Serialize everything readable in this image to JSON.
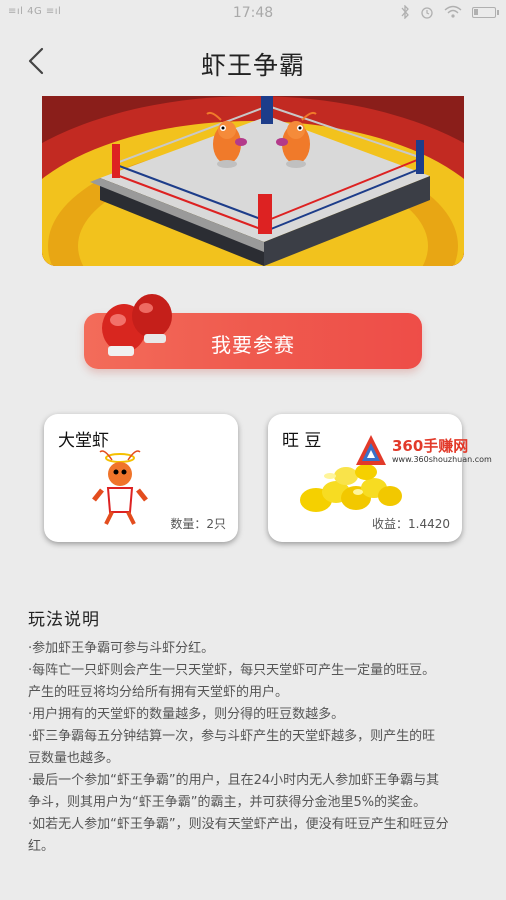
{
  "status_bar": {
    "signal_text": "≡ıl 4G ≡ıl",
    "time": "17:48"
  },
  "header": {
    "title": "虾王争霸",
    "back_icon": "chevron-left-icon"
  },
  "join_button": {
    "label": "我要参赛"
  },
  "cards": {
    "shrimp": {
      "title": "大堂虾",
      "value": "数量：2只"
    },
    "beans": {
      "title": "旺 豆",
      "value": "收益：1.4420"
    }
  },
  "watermark": {
    "title": "360手赚网",
    "url": "www.360shouzhuan.com"
  },
  "rules": {
    "title": "玩法说明",
    "lines": [
      "·参加虾王争霸可参与斗虾分红。",
      "·每阵亡一只虾则会产生一只天堂虾，每只天堂虾可产生一定量的旺豆。",
      "产生的旺豆将均分给所有拥有天堂虾的用户。",
      "·用户拥有的天堂虾的数量越多，则分得的旺豆数越多。",
      "·虾三争霸每五分钟结算一次，参与斗虾产生的天堂虾越多，则产生的旺",
      "豆数量也越多。",
      "·最后一个参加“虾王争霸”的用户，且在24小时内无人参加虾王争霸与其",
      "争斗，则其用户为“虾王争霸”的霸主，并可获得分金池里5%的奖金。",
      "·如若无人参加“虾王争霸”，则没有天堂虾产出，便没有旺豆产生和旺豆分",
      "红。"
    ]
  },
  "colors": {
    "background": "#ebebeb",
    "accent": "#ef5a4e",
    "ring_floor": "#f2c21d"
  }
}
